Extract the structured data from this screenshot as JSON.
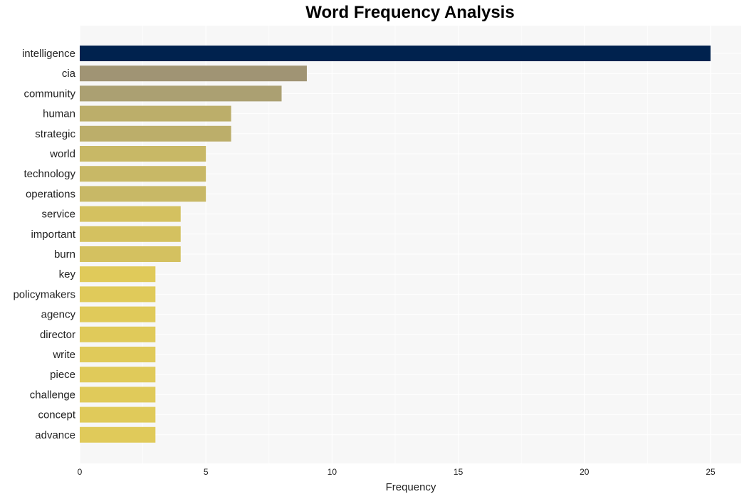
{
  "chart_data": {
    "type": "bar",
    "orientation": "horizontal",
    "title": "Word Frequency Analysis",
    "xlabel": "Frequency",
    "ylabel": "",
    "xlim": [
      0,
      26.2
    ],
    "xticks": [
      0,
      5,
      10,
      15,
      20,
      25
    ],
    "grid": true,
    "categories": [
      "intelligence",
      "cia",
      "community",
      "human",
      "strategic",
      "world",
      "technology",
      "operations",
      "service",
      "important",
      "burn",
      "key",
      "policymakers",
      "agency",
      "director",
      "write",
      "piece",
      "challenge",
      "concept",
      "advance"
    ],
    "values": [
      25,
      9,
      8,
      6,
      6,
      5,
      5,
      5,
      4,
      4,
      4,
      3,
      3,
      3,
      3,
      3,
      3,
      3,
      3,
      3
    ],
    "colors": [
      "#00224e",
      "#a09474",
      "#aba072",
      "#bcae6a",
      "#bcae6a",
      "#c8b866",
      "#c8b866",
      "#c8b866",
      "#d4c160",
      "#d4c160",
      "#d4c160",
      "#e0ca5a",
      "#e0ca5a",
      "#e0ca5a",
      "#e0ca5a",
      "#e0ca5a",
      "#e0ca5a",
      "#e0ca5a",
      "#e0ca5a",
      "#e0ca5a"
    ],
    "background": "#f7f7f7"
  }
}
